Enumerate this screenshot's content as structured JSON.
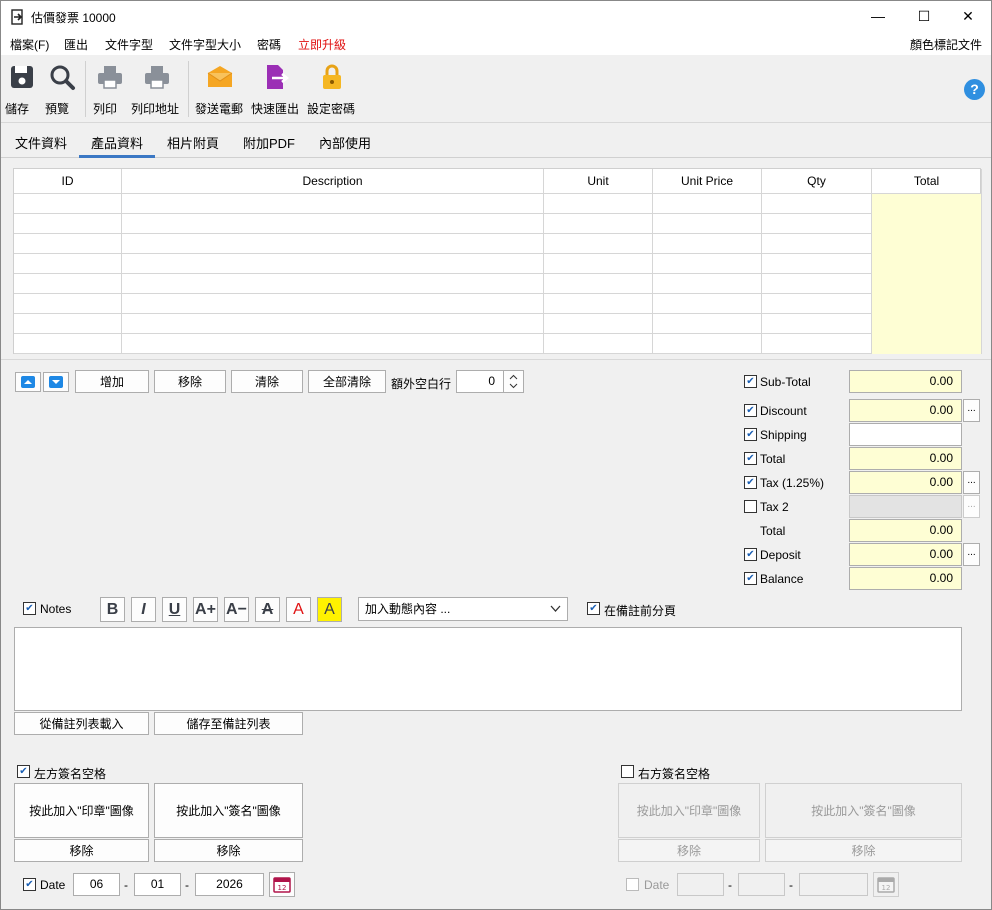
{
  "window": {
    "title": "估價發票 10000",
    "minimize": "—",
    "maximize": "☐",
    "close": "✕"
  },
  "menu": {
    "items": [
      "檔案(F)",
      "匯出",
      "文件字型",
      "文件字型大小",
      "密碼",
      "立即升級"
    ],
    "right": "顏色標記文件",
    "upgrade_color": "#e01010"
  },
  "toolbar": {
    "buttons": [
      {
        "label": "儲存",
        "icon": "save-icon"
      },
      {
        "label": "預覽",
        "icon": "magnifier-icon"
      },
      {
        "label": "列印",
        "icon": "printer-icon"
      },
      {
        "label": "列印地址",
        "icon": "printer-address-icon"
      },
      {
        "label": "發送電郵",
        "icon": "envelope-icon"
      },
      {
        "label": "快速匯出",
        "icon": "export-file-icon"
      },
      {
        "label": "設定密碼",
        "icon": "lock-icon"
      }
    ],
    "help": "?"
  },
  "tabs": [
    "文件資料",
    "產品資料",
    "相片附頁",
    "附加PDF",
    "內部使用"
  ],
  "grid": {
    "columns": [
      "ID",
      "Description",
      "Unit",
      "Unit Price",
      "Qty",
      "Total"
    ]
  },
  "actions": {
    "add": "增加",
    "remove": "移除",
    "clear": "清除",
    "clear_all": "全部清除",
    "extra_rows_label": "額外空白行",
    "extra_rows_value": "0"
  },
  "totals": {
    "subtotal": {
      "label": "Sub-Total",
      "value": "0.00"
    },
    "discount": {
      "label": "Discount",
      "value": "0.00"
    },
    "shipping": {
      "label": "Shipping",
      "value": ""
    },
    "total": {
      "label": "Total",
      "value": "0.00"
    },
    "tax": {
      "label": "Tax (1.25%)",
      "value": "0.00"
    },
    "tax2": {
      "label": "Tax 2",
      "value": ""
    },
    "total2": {
      "label": "Total",
      "value": "0.00"
    },
    "deposit": {
      "label": "Deposit",
      "value": "0.00"
    },
    "balance": {
      "label": "Balance",
      "value": "0.00"
    },
    "dots": "..."
  },
  "notes": {
    "label": "Notes",
    "dropdown": "加入動態內容 ...",
    "page_break": "在備註前分頁",
    "load_btn": "從備註列表載入",
    "save_btn": "儲存至備註列表"
  },
  "signature": {
    "left_label": "左方簽名空格",
    "right_label": "右方簽名空格",
    "stamp_btn": "按此加入\"印章\"圖像",
    "sign_btn": "按此加入\"簽名\"圖像",
    "remove": "移除"
  },
  "date": {
    "label": "Date",
    "day": "06",
    "month": "01",
    "year": "2026",
    "sep": "-"
  },
  "colors": {
    "accent": "#3b78c4",
    "total_bg": "#fefed4"
  }
}
